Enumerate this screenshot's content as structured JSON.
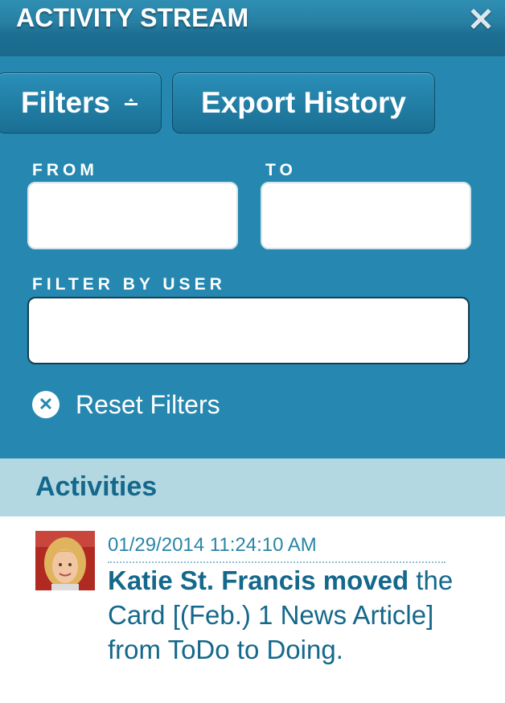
{
  "header": {
    "title": "ACTIVITY STREAM",
    "close_icon": "close-icon"
  },
  "toolbar": {
    "filters_label": "Filters",
    "filters_icon": "caret-up-icon",
    "export_label": "Export History"
  },
  "filters": {
    "from_label": "FROM",
    "from_value": "",
    "to_label": "TO",
    "to_value": "",
    "user_label": "FILTER BY USER",
    "user_value": "",
    "reset_label": "Reset Filters",
    "reset_icon": "close-circle-icon"
  },
  "activities": {
    "heading": "Activities",
    "items": [
      {
        "timestamp": "01/29/2014 11:24:10 AM",
        "actor": "Katie St. Francis moved",
        "message": "the Card [(Feb.) 1 News Article] from ToDo to Doing."
      }
    ]
  },
  "colors": {
    "header": "#1d6f92",
    "panel": "#2688b0",
    "activities_bar": "#b3d8e2",
    "text_blue": "#14688b"
  }
}
